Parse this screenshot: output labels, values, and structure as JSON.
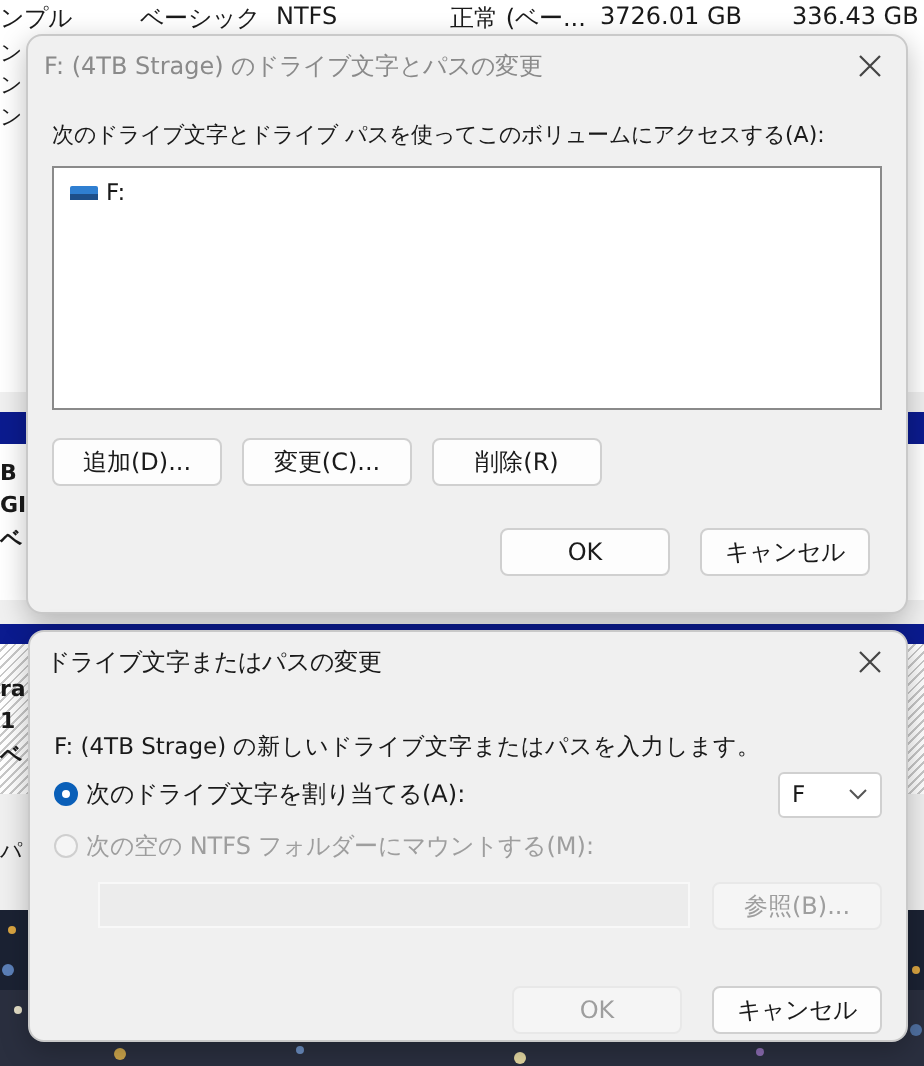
{
  "background": {
    "row": [
      "ンプル",
      "ベーシック",
      "NTFS",
      "正常 (ベー...",
      "3726.01 GB",
      "336.43 GB"
    ],
    "fragments": [
      "ン",
      "ン",
      "ン",
      "B",
      "GI",
      "ベ",
      "ra",
      "1",
      "ベ",
      "パ"
    ]
  },
  "paths_dialog": {
    "title": "F: (4TB Strage) のドライブ文字とパスの変更",
    "label": "次のドライブ文字とドライブ パスを使ってこのボリュームにアクセスする(A):",
    "items": [
      {
        "label": "F:",
        "selected": false
      }
    ],
    "buttons": [
      "追加(D)...",
      "変更(C)...",
      "削除(R)"
    ],
    "footer_buttons": [
      {
        "label": "OK",
        "disabled": false
      },
      {
        "label": "キャンセル",
        "disabled": false
      }
    ]
  },
  "change_dialog": {
    "title": "ドライブ文字またはパスの変更",
    "description": "F: (4TB Strage) の新しいドライブ文字またはパスを入力します。",
    "options": [
      {
        "label": "次のドライブ文字を割り当てる(A):",
        "selected": true,
        "disabled": false
      },
      {
        "label": "次の空の NTFS フォルダーにマウントする(M):",
        "selected": false,
        "disabled": true
      }
    ],
    "drive_letter": {
      "value": "F"
    },
    "path_field": {
      "disabled": true
    },
    "browse_button": {
      "label": "参照(B)...",
      "disabled": true
    },
    "footer_buttons": [
      {
        "label": "OK",
        "disabled": true
      },
      {
        "label": "キャンセル",
        "disabled": false
      }
    ]
  }
}
